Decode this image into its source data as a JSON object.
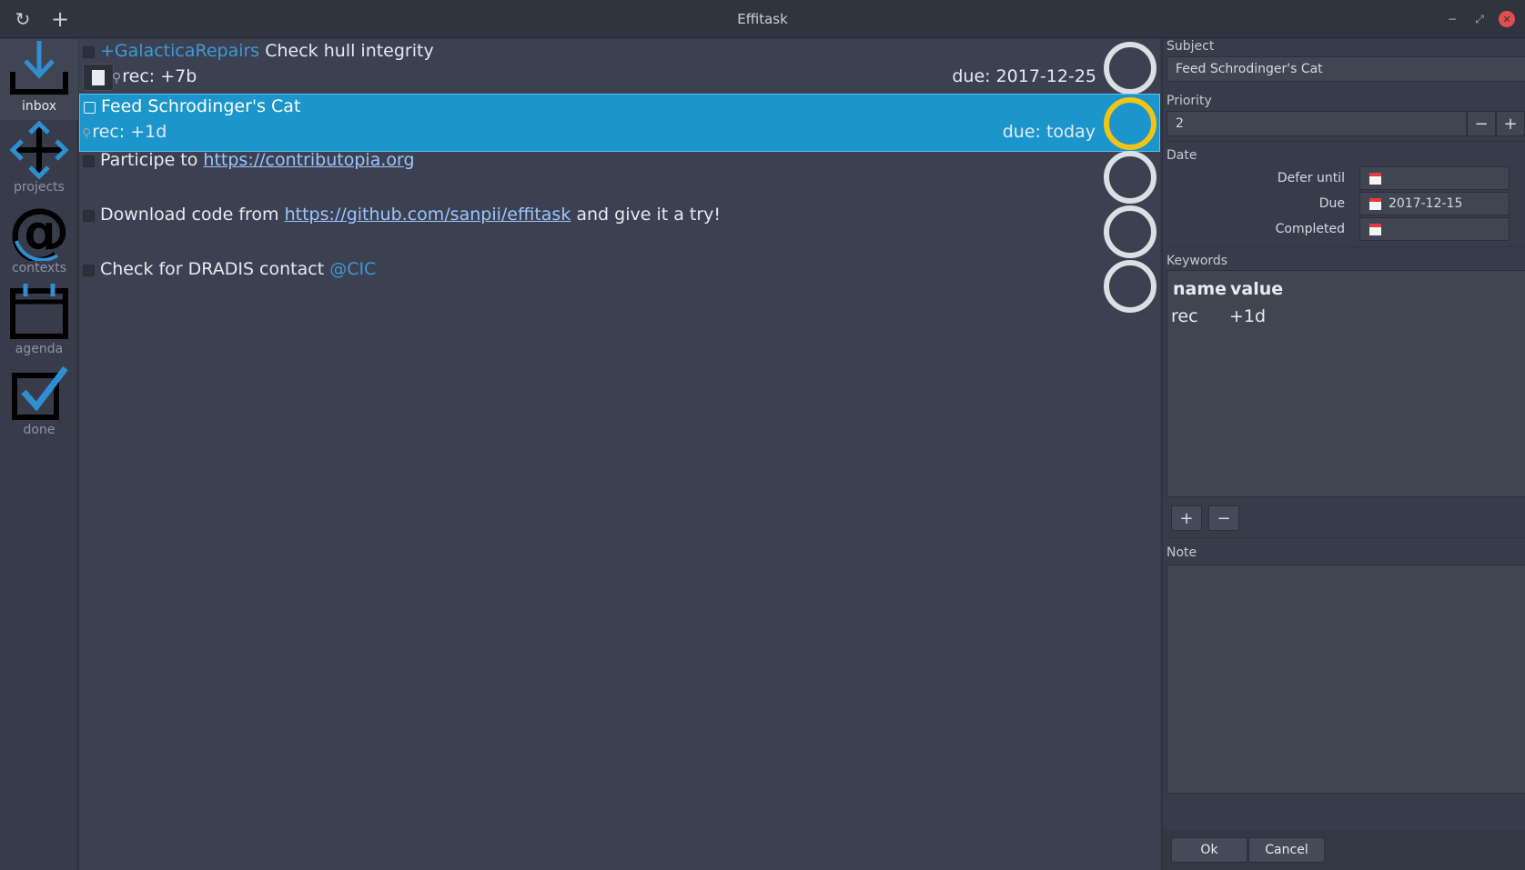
{
  "window": {
    "title": "Effitask",
    "refresh_icon": "↻",
    "add_icon": "+",
    "minimize_icon": "−",
    "maximize_icon": "⤢",
    "close_icon": "✕"
  },
  "sidebar": {
    "items": [
      {
        "label": "inbox",
        "icon": "inbox-icon",
        "active": true
      },
      {
        "label": "projects",
        "icon": "projects-icon",
        "active": false
      },
      {
        "label": "contexts",
        "icon": "contexts-icon",
        "active": false
      },
      {
        "label": "agenda",
        "icon": "agenda-icon",
        "active": false
      },
      {
        "label": "done",
        "icon": "done-icon",
        "active": false
      }
    ]
  },
  "tasks": [
    {
      "project": "+GalacticaRepairs",
      "text": " Check hull integrity",
      "recurrence": "rec: +7b",
      "due": "due: 2017-12-25",
      "has_note": true,
      "priority_color": "#dcdfe3"
    },
    {
      "text": "Feed Schrodinger's Cat",
      "recurrence": "rec: +1d",
      "due": "due: today",
      "selected": true,
      "priority_color": "#f4c415"
    },
    {
      "text_before": "Participe to ",
      "link": "https://contributopia.org"
    },
    {
      "text_before": "Download code from ",
      "link": "https://github.com/sanpii/effitask",
      "text_after": " and give it a try!"
    },
    {
      "text_before": "Check for DRADIS contact ",
      "context": "@CIC"
    }
  ],
  "edit_panel": {
    "subject_label": "Subject",
    "subject_value": "Feed Schrodinger's Cat",
    "priority_label": "Priority",
    "priority_value": "2",
    "priority_decrement": "−",
    "priority_increment": "+",
    "date_label": "Date",
    "defer_label": "Defer until",
    "defer_value": "",
    "due_label": "Due",
    "due_value": "2017-12-15",
    "completed_label": "Completed",
    "completed_value": "",
    "keywords_label": "Keywords",
    "keywords_columns": [
      "name",
      "value"
    ],
    "keywords_rows": [
      {
        "name": "rec",
        "value": "+1d"
      }
    ],
    "add_keyword": "+",
    "remove_keyword": "−",
    "note_label": "Note",
    "note_value": "",
    "ok_label": "Ok",
    "cancel_label": "Cancel"
  },
  "colors": {
    "accent": "#1b95cb",
    "link": "#9ec4ff",
    "tag": "#3f99d6",
    "priority_high": "#f4c415"
  }
}
